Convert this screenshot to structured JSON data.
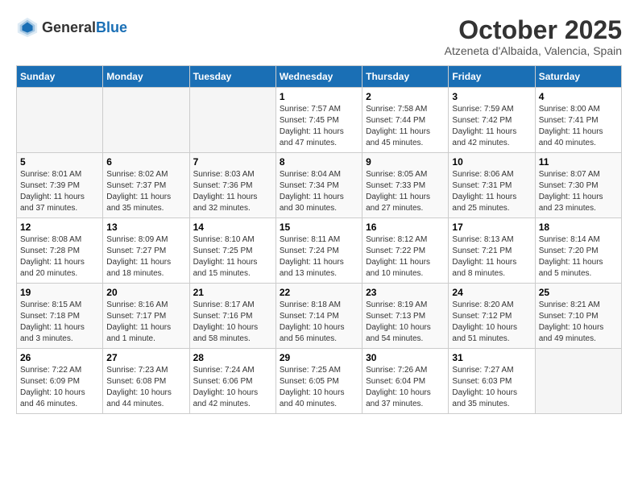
{
  "header": {
    "logo": {
      "general": "General",
      "blue": "Blue"
    },
    "title": "October 2025",
    "subtitle": "Atzeneta d'Albaida, Valencia, Spain"
  },
  "days_of_week": [
    "Sunday",
    "Monday",
    "Tuesday",
    "Wednesday",
    "Thursday",
    "Friday",
    "Saturday"
  ],
  "weeks": [
    [
      {
        "day": "",
        "sunrise": "",
        "sunset": "",
        "daylight": "",
        "empty": true
      },
      {
        "day": "",
        "sunrise": "",
        "sunset": "",
        "daylight": "",
        "empty": true
      },
      {
        "day": "",
        "sunrise": "",
        "sunset": "",
        "daylight": "",
        "empty": true
      },
      {
        "day": "1",
        "sunrise": "Sunrise: 7:57 AM",
        "sunset": "Sunset: 7:45 PM",
        "daylight": "Daylight: 11 hours and 47 minutes.",
        "empty": false
      },
      {
        "day": "2",
        "sunrise": "Sunrise: 7:58 AM",
        "sunset": "Sunset: 7:44 PM",
        "daylight": "Daylight: 11 hours and 45 minutes.",
        "empty": false
      },
      {
        "day": "3",
        "sunrise": "Sunrise: 7:59 AM",
        "sunset": "Sunset: 7:42 PM",
        "daylight": "Daylight: 11 hours and 42 minutes.",
        "empty": false
      },
      {
        "day": "4",
        "sunrise": "Sunrise: 8:00 AM",
        "sunset": "Sunset: 7:41 PM",
        "daylight": "Daylight: 11 hours and 40 minutes.",
        "empty": false
      }
    ],
    [
      {
        "day": "5",
        "sunrise": "Sunrise: 8:01 AM",
        "sunset": "Sunset: 7:39 PM",
        "daylight": "Daylight: 11 hours and 37 minutes.",
        "empty": false
      },
      {
        "day": "6",
        "sunrise": "Sunrise: 8:02 AM",
        "sunset": "Sunset: 7:37 PM",
        "daylight": "Daylight: 11 hours and 35 minutes.",
        "empty": false
      },
      {
        "day": "7",
        "sunrise": "Sunrise: 8:03 AM",
        "sunset": "Sunset: 7:36 PM",
        "daylight": "Daylight: 11 hours and 32 minutes.",
        "empty": false
      },
      {
        "day": "8",
        "sunrise": "Sunrise: 8:04 AM",
        "sunset": "Sunset: 7:34 PM",
        "daylight": "Daylight: 11 hours and 30 minutes.",
        "empty": false
      },
      {
        "day": "9",
        "sunrise": "Sunrise: 8:05 AM",
        "sunset": "Sunset: 7:33 PM",
        "daylight": "Daylight: 11 hours and 27 minutes.",
        "empty": false
      },
      {
        "day": "10",
        "sunrise": "Sunrise: 8:06 AM",
        "sunset": "Sunset: 7:31 PM",
        "daylight": "Daylight: 11 hours and 25 minutes.",
        "empty": false
      },
      {
        "day": "11",
        "sunrise": "Sunrise: 8:07 AM",
        "sunset": "Sunset: 7:30 PM",
        "daylight": "Daylight: 11 hours and 23 minutes.",
        "empty": false
      }
    ],
    [
      {
        "day": "12",
        "sunrise": "Sunrise: 8:08 AM",
        "sunset": "Sunset: 7:28 PM",
        "daylight": "Daylight: 11 hours and 20 minutes.",
        "empty": false
      },
      {
        "day": "13",
        "sunrise": "Sunrise: 8:09 AM",
        "sunset": "Sunset: 7:27 PM",
        "daylight": "Daylight: 11 hours and 18 minutes.",
        "empty": false
      },
      {
        "day": "14",
        "sunrise": "Sunrise: 8:10 AM",
        "sunset": "Sunset: 7:25 PM",
        "daylight": "Daylight: 11 hours and 15 minutes.",
        "empty": false
      },
      {
        "day": "15",
        "sunrise": "Sunrise: 8:11 AM",
        "sunset": "Sunset: 7:24 PM",
        "daylight": "Daylight: 11 hours and 13 minutes.",
        "empty": false
      },
      {
        "day": "16",
        "sunrise": "Sunrise: 8:12 AM",
        "sunset": "Sunset: 7:22 PM",
        "daylight": "Daylight: 11 hours and 10 minutes.",
        "empty": false
      },
      {
        "day": "17",
        "sunrise": "Sunrise: 8:13 AM",
        "sunset": "Sunset: 7:21 PM",
        "daylight": "Daylight: 11 hours and 8 minutes.",
        "empty": false
      },
      {
        "day": "18",
        "sunrise": "Sunrise: 8:14 AM",
        "sunset": "Sunset: 7:20 PM",
        "daylight": "Daylight: 11 hours and 5 minutes.",
        "empty": false
      }
    ],
    [
      {
        "day": "19",
        "sunrise": "Sunrise: 8:15 AM",
        "sunset": "Sunset: 7:18 PM",
        "daylight": "Daylight: 11 hours and 3 minutes.",
        "empty": false
      },
      {
        "day": "20",
        "sunrise": "Sunrise: 8:16 AM",
        "sunset": "Sunset: 7:17 PM",
        "daylight": "Daylight: 11 hours and 1 minute.",
        "empty": false
      },
      {
        "day": "21",
        "sunrise": "Sunrise: 8:17 AM",
        "sunset": "Sunset: 7:16 PM",
        "daylight": "Daylight: 10 hours and 58 minutes.",
        "empty": false
      },
      {
        "day": "22",
        "sunrise": "Sunrise: 8:18 AM",
        "sunset": "Sunset: 7:14 PM",
        "daylight": "Daylight: 10 hours and 56 minutes.",
        "empty": false
      },
      {
        "day": "23",
        "sunrise": "Sunrise: 8:19 AM",
        "sunset": "Sunset: 7:13 PM",
        "daylight": "Daylight: 10 hours and 54 minutes.",
        "empty": false
      },
      {
        "day": "24",
        "sunrise": "Sunrise: 8:20 AM",
        "sunset": "Sunset: 7:12 PM",
        "daylight": "Daylight: 10 hours and 51 minutes.",
        "empty": false
      },
      {
        "day": "25",
        "sunrise": "Sunrise: 8:21 AM",
        "sunset": "Sunset: 7:10 PM",
        "daylight": "Daylight: 10 hours and 49 minutes.",
        "empty": false
      }
    ],
    [
      {
        "day": "26",
        "sunrise": "Sunrise: 7:22 AM",
        "sunset": "Sunset: 6:09 PM",
        "daylight": "Daylight: 10 hours and 46 minutes.",
        "empty": false
      },
      {
        "day": "27",
        "sunrise": "Sunrise: 7:23 AM",
        "sunset": "Sunset: 6:08 PM",
        "daylight": "Daylight: 10 hours and 44 minutes.",
        "empty": false
      },
      {
        "day": "28",
        "sunrise": "Sunrise: 7:24 AM",
        "sunset": "Sunset: 6:06 PM",
        "daylight": "Daylight: 10 hours and 42 minutes.",
        "empty": false
      },
      {
        "day": "29",
        "sunrise": "Sunrise: 7:25 AM",
        "sunset": "Sunset: 6:05 PM",
        "daylight": "Daylight: 10 hours and 40 minutes.",
        "empty": false
      },
      {
        "day": "30",
        "sunrise": "Sunrise: 7:26 AM",
        "sunset": "Sunset: 6:04 PM",
        "daylight": "Daylight: 10 hours and 37 minutes.",
        "empty": false
      },
      {
        "day": "31",
        "sunrise": "Sunrise: 7:27 AM",
        "sunset": "Sunset: 6:03 PM",
        "daylight": "Daylight: 10 hours and 35 minutes.",
        "empty": false
      },
      {
        "day": "",
        "sunrise": "",
        "sunset": "",
        "daylight": "",
        "empty": true
      }
    ]
  ]
}
